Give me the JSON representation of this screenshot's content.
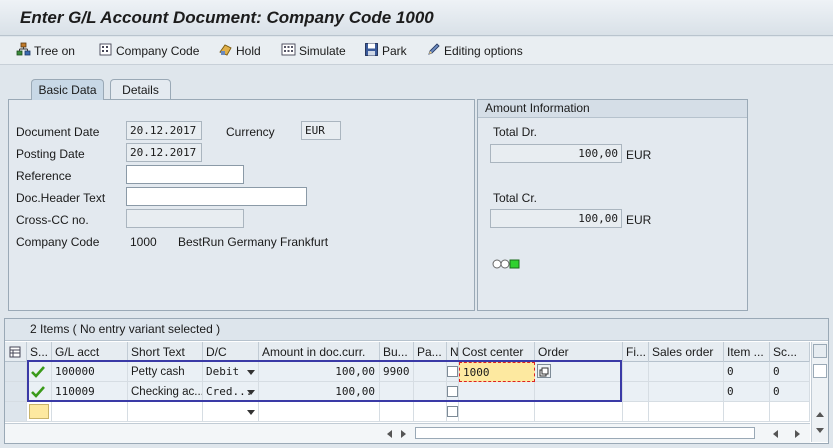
{
  "window": {
    "title": "Enter G/L Account Document: Company Code 1000"
  },
  "toolbar": {
    "tree_on": "Tree on",
    "company_code": "Company Code",
    "hold": "Hold",
    "simulate": "Simulate",
    "park": "Park",
    "editing_options": "Editing options"
  },
  "tabs": {
    "basic_data": "Basic Data",
    "details": "Details"
  },
  "basic": {
    "document_date_label": "Document Date",
    "document_date": "20.12.2017",
    "currency_label": "Currency",
    "currency": "EUR",
    "posting_date_label": "Posting Date",
    "posting_date": "20.12.2017",
    "reference_label": "Reference",
    "reference": "",
    "doc_header_label": "Doc.Header Text",
    "doc_header": "",
    "cross_cc_label": "Cross-CC no.",
    "cross_cc": "",
    "company_code_label": "Company Code",
    "company_code": "1000",
    "company_name": "BestRun Germany Frankfurt"
  },
  "amount_info": {
    "title": "Amount Information",
    "total_dr_label": "Total Dr.",
    "total_dr": "100,00",
    "total_dr_cur": "EUR",
    "total_cr_label": "Total Cr.",
    "total_cr": "100,00",
    "total_cr_cur": "EUR"
  },
  "items": {
    "title": "2 Items ( No entry variant selected )",
    "headers": {
      "status": "S...",
      "gl_acct": "G/L acct",
      "short_text": "Short Text",
      "dc": "D/C",
      "amount": "Amount in doc.curr.",
      "bu": "Bu...",
      "pa": "Pa...",
      "n": "N",
      "cost_center": "Cost center",
      "order": "Order",
      "fi": "Fi...",
      "sales_order": "Sales order",
      "item": "Item ...",
      "sc": "Sc..."
    },
    "rows": [
      {
        "gl_acct": "100000",
        "short_text": "Petty cash",
        "dc": "Debit",
        "amount": "100,00",
        "bu": "9900",
        "cost_center": "1000",
        "item": "0",
        "sc": "0"
      },
      {
        "gl_acct": "110009",
        "short_text": "Checking ac...",
        "dc": "Cred...",
        "amount": "100,00",
        "bu": "",
        "cost_center": "",
        "item": "0",
        "sc": "0"
      }
    ]
  }
}
